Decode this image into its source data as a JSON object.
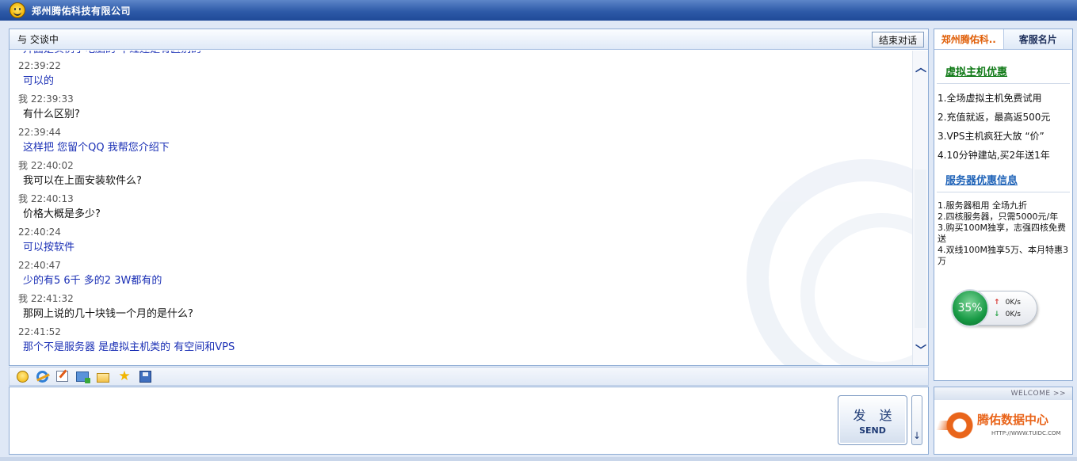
{
  "window": {
    "title": "郑州腾佑科技有限公司"
  },
  "chat": {
    "status": "与 交谈中",
    "end_button": "结束对话",
    "messages": [
      {
        "from": "them",
        "time": "",
        "text": "升面是实例了电脑的 不过还是有区别的"
      },
      {
        "from": "them",
        "time": "22:39:22",
        "text": "可以的"
      },
      {
        "from": "me",
        "time": "我 22:39:33",
        "text": "有什么区别?"
      },
      {
        "from": "them",
        "time": "22:39:44",
        "text": "这样把 您留个QQ 我帮您介绍下"
      },
      {
        "from": "me",
        "time": "我 22:40:02",
        "text": "我可以在上面安装软件么?"
      },
      {
        "from": "me",
        "time": "我 22:40:13",
        "text": "价格大概是多少?"
      },
      {
        "from": "them",
        "time": "22:40:24",
        "text": "可以按软件"
      },
      {
        "from": "them",
        "time": "22:40:47",
        "text": "少的有5 6千 多的2 3W都有的"
      },
      {
        "from": "me",
        "time": "我 22:41:32",
        "text": "那网上说的几十块钱一个月的是什么?"
      },
      {
        "from": "them",
        "time": "22:41:52",
        "text": "那个不是服务器 是虚拟主机类的 有空间和VPS"
      }
    ]
  },
  "toolbar": {
    "icons": [
      "smiley-icon",
      "browser-icon",
      "edit-icon",
      "screenshot-icon",
      "folder-icon",
      "favorite-star-icon",
      "save-icon"
    ]
  },
  "input": {
    "send_cn": "发 送",
    "send_en": "SEND",
    "send_option": "↓"
  },
  "side": {
    "tab_company": "郑州腾佑科..",
    "tab_card": "客服名片",
    "vhost_title": "虚拟主机优惠",
    "vhost_items": [
      "1.全场虚拟主机免费试用",
      "2.充值就返，最高返500元",
      "3.VPS主机疯狂大放 “价”",
      "4.10分钟建站,买2年送1年"
    ],
    "server_title": "服务器优惠信息",
    "server_items": [
      "1.服务器租用 全场九折",
      "2.四核服务器，只需5000元/年",
      "3.购买100M独享，志强四核免费送",
      "4.双线100M独享5万、本月特惠3万"
    ],
    "speed": {
      "percent": "35%",
      "up": "0K/s",
      "down": "0K/s"
    }
  },
  "welcome": {
    "label": "WELCOME >>",
    "brand": "腾佑数据中心",
    "url": "HTTP://WWW.TUIDC.COM"
  },
  "colors": {
    "them_text": "#1a2fb5",
    "me_text": "#111111",
    "titlebar": "#2e5aa8",
    "tab_active": "#e0600a"
  }
}
